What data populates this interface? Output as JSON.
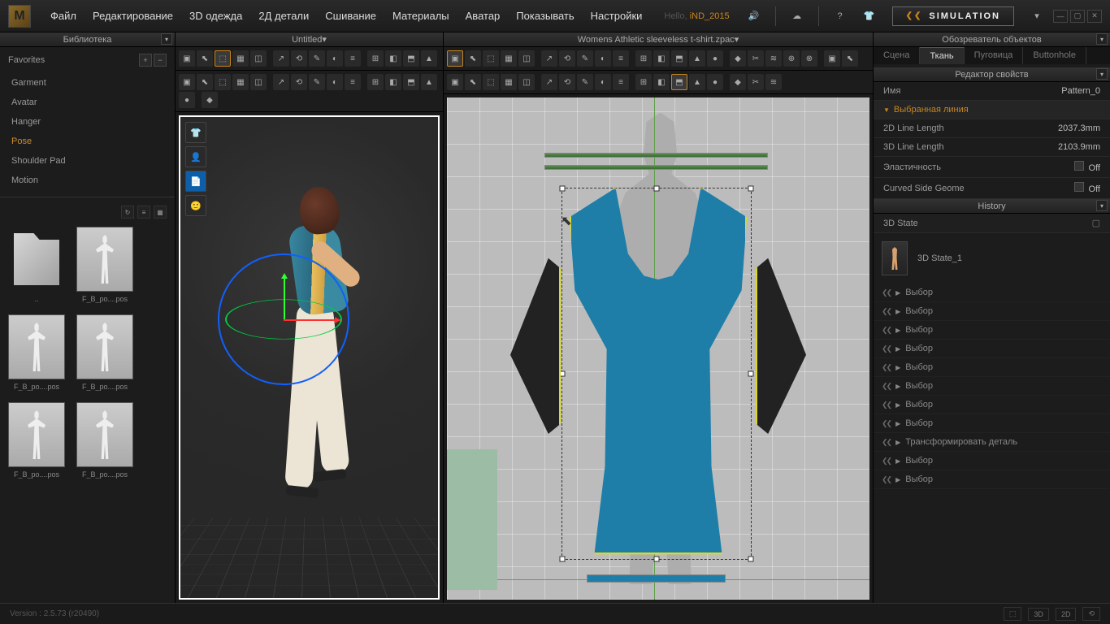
{
  "menu": [
    "Файл",
    "Редактирование",
    "3D одежда",
    "2Д детали",
    "Сшивание",
    "Материалы",
    "Аватар",
    "Показывать",
    "Настройки"
  ],
  "user": {
    "greeting": "Hello,",
    "name": "iND_2015"
  },
  "simulation_label": "SIMULATION",
  "library": {
    "title": "Библиотека",
    "favorites_label": "Favorites",
    "items": [
      "Garment",
      "Avatar",
      "Hanger",
      "Pose",
      "Shoulder Pad",
      "Motion"
    ],
    "selected_index": 3,
    "thumbnails": [
      {
        "label": "..",
        "folder": true
      },
      {
        "label": "F_B_po....pos"
      },
      {
        "label": "F_B_po....pos"
      },
      {
        "label": "F_B_po....pos"
      },
      {
        "label": "F_B_po....pos"
      },
      {
        "label": "F_B_po....pos"
      }
    ]
  },
  "viewport3d": {
    "title": "Untitled"
  },
  "viewport2d": {
    "title": "Womens Athletic sleeveless t-shirt.zpac"
  },
  "object_browser": {
    "title": "Обозреватель объектов",
    "tabs": [
      "Сцена",
      "Ткань",
      "Пуговица",
      "Buttonhole"
    ],
    "selected_tab": 1
  },
  "property_editor": {
    "title": "Редактор свойств",
    "name_label": "Имя",
    "name_value": "Pattern_0",
    "section": "Выбранная линия",
    "rows": [
      {
        "k": "2D Line Length",
        "v": "2037.3mm"
      },
      {
        "k": "3D Line Length",
        "v": "2103.9mm"
      },
      {
        "k": "Эластичность",
        "v": "Off",
        "chk": true
      },
      {
        "k": "Curved Side Geome",
        "v": "Off",
        "chk": true
      }
    ]
  },
  "history": {
    "title": "History",
    "state_label": "3D State",
    "state_name": "3D State_1",
    "items": [
      "Выбор",
      "Выбор",
      "Выбор",
      "Выбор",
      "Выбор",
      "Выбор",
      "Выбор",
      "Выбор",
      "Трансформировать деталь",
      "Выбор",
      "Выбор"
    ]
  },
  "status": {
    "version": "Version : 2.5.73    (r20490)",
    "modes": [
      "3D",
      "2D"
    ]
  }
}
